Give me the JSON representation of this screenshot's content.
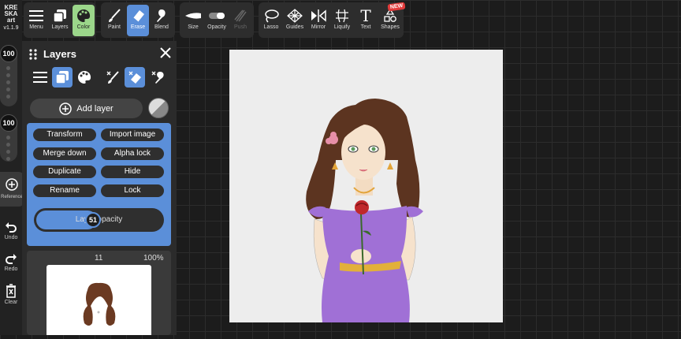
{
  "app": {
    "logo_line1": "KRE",
    "logo_line2": "SKA",
    "logo_line3": "art",
    "version": "v1.1.9"
  },
  "rail": {
    "brush_size": "100",
    "brush_opacity": "100",
    "reference_label": "Reference",
    "undo_label": "Undo",
    "redo_label": "Redo",
    "clear_label": "Clear"
  },
  "toolbar": {
    "menu": "Menu",
    "layers": "Layers",
    "color": "Color",
    "paint": "Paint",
    "erase": "Erase",
    "blend": "Blend",
    "size": "Size",
    "opacity": "Opacity",
    "push": "Push",
    "lasso": "Lasso",
    "guides": "Guides",
    "mirror": "Mirror",
    "liquify": "Liquify",
    "text": "Text",
    "shapes": "Shapes",
    "new_badge": "NEW",
    "text_icon_glyph": "T"
  },
  "panel": {
    "title": "Layers",
    "add_layer": "Add layer",
    "options": {
      "transform": "Transform",
      "import_image": "Import image",
      "merge_down": "Merge down",
      "alpha_lock": "Alpha lock",
      "duplicate": "Duplicate",
      "hide": "Hide",
      "rename": "Rename",
      "lock": "Lock"
    },
    "layer_opacity_label": "Layer opacity",
    "layer_opacity_value": "51",
    "layer_opacity_fraction": 0.51,
    "layer_item": {
      "number": "11",
      "opacity": "100%"
    }
  },
  "colors": {
    "accent_blue": "#5b8fd9",
    "color_active_green": "#9bd68a",
    "new_badge_red": "#e23b3b"
  }
}
